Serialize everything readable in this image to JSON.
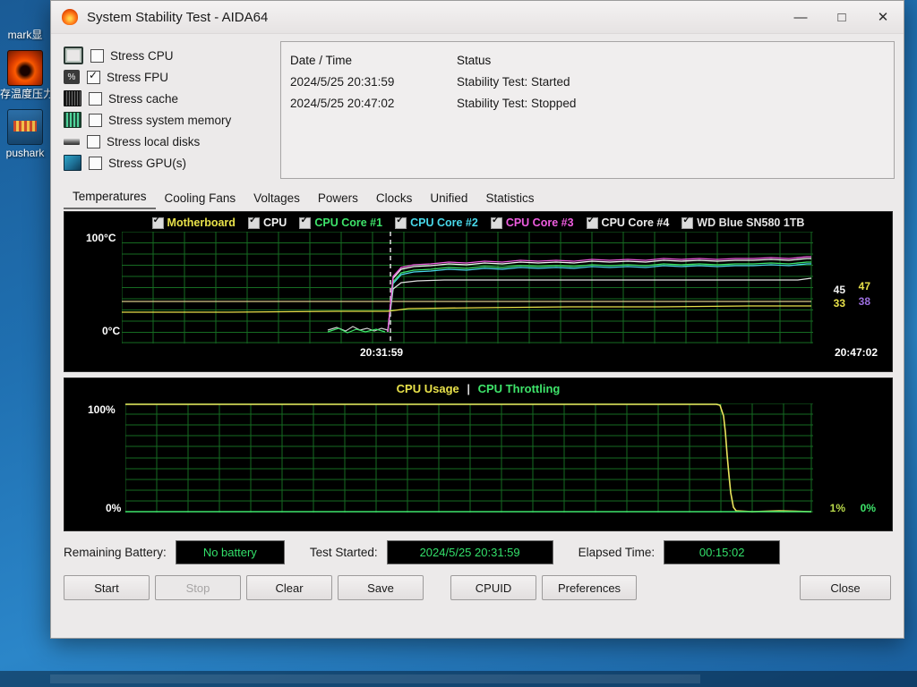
{
  "desktop": {
    "icons": [
      {
        "label": "mark显",
        "glyph": "none"
      },
      {
        "label": "存温度压力\n测试",
        "glyph": "fire-icon"
      },
      {
        "label": "pushark",
        "glyph": "gpu-card-icon"
      }
    ]
  },
  "window": {
    "title": "System Stability Test - AIDA64",
    "app_icon": "flame-icon",
    "controls": {
      "minimize": "—",
      "maximize": "□",
      "close": "✕"
    }
  },
  "stress_options": [
    {
      "label": "Stress CPU",
      "checked": false,
      "icon": "cpu-chip-icon"
    },
    {
      "label": "Stress FPU",
      "checked": true,
      "icon": "fpu-percent-icon"
    },
    {
      "label": "Stress cache",
      "checked": false,
      "icon": "cache-icon"
    },
    {
      "label": "Stress system memory",
      "checked": false,
      "icon": "memory-module-icon"
    },
    {
      "label": "Stress local disks",
      "checked": false,
      "icon": "disk-icon"
    },
    {
      "label": "Stress GPU(s)",
      "checked": false,
      "icon": "gpu-icon"
    }
  ],
  "log": {
    "headers": {
      "datetime": "Date / Time",
      "status": "Status"
    },
    "rows": [
      {
        "datetime": "2024/5/25 20:31:59",
        "status": "Stability Test: Started"
      },
      {
        "datetime": "2024/5/25 20:47:02",
        "status": "Stability Test: Stopped"
      }
    ]
  },
  "tabs": [
    {
      "label": "Temperatures",
      "active": true
    },
    {
      "label": "Cooling Fans",
      "active": false
    },
    {
      "label": "Voltages",
      "active": false
    },
    {
      "label": "Powers",
      "active": false
    },
    {
      "label": "Clocks",
      "active": false
    },
    {
      "label": "Unified",
      "active": false
    },
    {
      "label": "Statistics",
      "active": false
    }
  ],
  "temperature_graph": {
    "legend": [
      {
        "label": "Motherboard",
        "color": "#e8e14a",
        "checked": true
      },
      {
        "label": "CPU",
        "color": "#f2f2f2",
        "checked": true
      },
      {
        "label": "CPU Core #1",
        "color": "#3ee46a",
        "checked": true
      },
      {
        "label": "CPU Core #2",
        "color": "#48d8ea",
        "checked": true
      },
      {
        "label": "CPU Core #3",
        "color": "#ef5de0",
        "checked": true
      },
      {
        "label": "CPU Core #4",
        "color": "#ededed",
        "checked": true
      },
      {
        "label": "WD Blue SN580 1TB",
        "color": "#e4e4e4",
        "checked": true
      }
    ],
    "y_top_label": "100°C",
    "y_bottom_label": "0°C",
    "x_start_label": "20:31:59",
    "x_end_label": "20:47:02",
    "current_values": {
      "row1_left": "45",
      "row1_right": "47",
      "row2_left": "33",
      "row2_right": "38"
    },
    "grid_color": "#1f8b2e",
    "background": "#000000"
  },
  "cpu_graph": {
    "title_usage": "CPU Usage",
    "title_separator": "|",
    "title_throttling": "CPU Throttling",
    "usage_color": "#e8e14a",
    "throttling_color": "#3ee46a",
    "y_top_label": "100%",
    "y_bottom_label": "0%",
    "current_values": {
      "usage": "1%",
      "throttling": "0%"
    }
  },
  "status": {
    "battery_label": "Remaining Battery:",
    "battery_value": "No battery",
    "test_started_label": "Test Started:",
    "test_started_value": "2024/5/25 20:31:59",
    "elapsed_label": "Elapsed Time:",
    "elapsed_value": "00:15:02"
  },
  "buttons": {
    "start": "Start",
    "stop": "Stop",
    "clear": "Clear",
    "save": "Save",
    "cpuid": "CPUID",
    "preferences": "Preferences",
    "close": "Close"
  },
  "chart_data": [
    {
      "type": "line",
      "title": "Temperatures",
      "xlabel": "",
      "ylabel": "°C",
      "ylim": [
        0,
        100
      ],
      "x": [
        "20:31:59",
        "20:47:02"
      ],
      "series": [
        {
          "name": "Motherboard",
          "color": "#e8e14a",
          "values": [
            31,
            31,
            31,
            32,
            33,
            33,
            33,
            33,
            33,
            33,
            33,
            33,
            33,
            33
          ]
        },
        {
          "name": "CPU",
          "color": "#f2f2f2",
          "values": [
            34,
            34,
            35,
            62,
            65,
            66,
            66,
            67,
            67,
            67,
            67,
            67,
            68,
            68
          ]
        },
        {
          "name": "CPU Core #1",
          "color": "#3ee46a",
          "values": [
            33,
            33,
            34,
            60,
            63,
            64,
            65,
            65,
            66,
            66,
            66,
            66,
            67,
            67
          ]
        },
        {
          "name": "CPU Core #2",
          "color": "#48d8ea",
          "values": [
            33,
            33,
            34,
            60,
            63,
            64,
            64,
            65,
            65,
            65,
            66,
            66,
            66,
            66
          ]
        },
        {
          "name": "CPU Core #3",
          "color": "#ef5de0",
          "values": [
            34,
            34,
            35,
            62,
            65,
            66,
            67,
            67,
            68,
            68,
            68,
            68,
            69,
            69
          ]
        },
        {
          "name": "CPU Core #4",
          "color": "#ededed",
          "values": [
            33,
            33,
            34,
            58,
            60,
            60,
            60,
            60,
            60,
            60,
            60,
            60,
            60,
            60
          ]
        },
        {
          "name": "WD Blue SN580 1TB",
          "color": "#e4e4e4",
          "values": [
            38,
            38,
            38,
            38,
            38,
            38,
            38,
            38,
            38,
            38,
            38,
            38,
            38,
            38
          ]
        }
      ],
      "legend_position": "top-center",
      "grid": true
    },
    {
      "type": "line",
      "title": "CPU Usage | CPU Throttling",
      "xlabel": "",
      "ylabel": "%",
      "ylim": [
        0,
        100
      ],
      "series": [
        {
          "name": "CPU Usage",
          "color": "#e8e14a",
          "values": [
            100,
            100,
            100,
            100,
            100,
            100,
            100,
            100,
            100,
            100,
            100,
            100,
            60,
            1
          ]
        },
        {
          "name": "CPU Throttling",
          "color": "#3ee46a",
          "values": [
            0,
            0,
            0,
            0,
            0,
            0,
            0,
            0,
            0,
            0,
            0,
            0,
            0,
            0
          ]
        }
      ],
      "legend_position": "top-center",
      "grid": true
    }
  ]
}
